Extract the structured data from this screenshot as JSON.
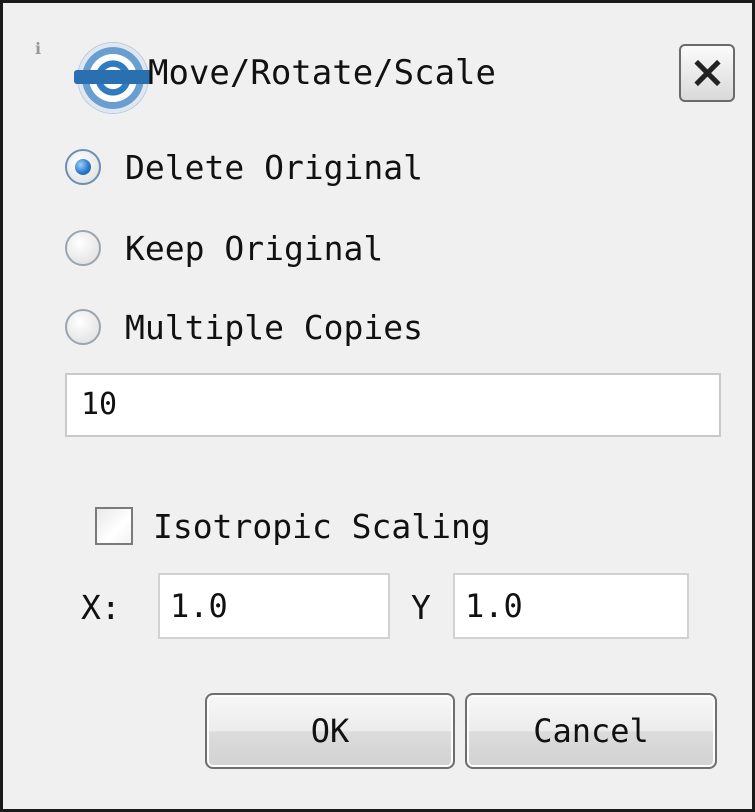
{
  "window": {
    "title": "Move/Rotate/Scale",
    "corner_mark": "ℹ",
    "logo_icon": "app-logo-icon",
    "close_icon": "close-icon"
  },
  "mode": {
    "options": [
      {
        "label": "Delete Original",
        "checked": true
      },
      {
        "label": "Keep Original",
        "checked": false
      },
      {
        "label": "Multiple Copies",
        "checked": false
      }
    ],
    "copies_value": "10"
  },
  "scaling": {
    "isotropic_label": "Isotropic Scaling",
    "isotropic_checked": false,
    "x_label": "X:",
    "x_value": "1.0",
    "y_label": "Y",
    "y_value": "1.0"
  },
  "buttons": {
    "ok_label": "OK",
    "cancel_label": "Cancel"
  },
  "colors": {
    "radio_selected": "#2b7bd0",
    "window_background": "#f0f0f0"
  }
}
